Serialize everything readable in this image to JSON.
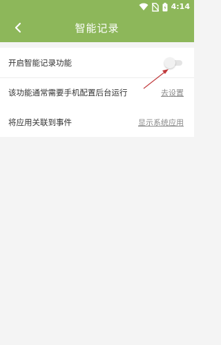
{
  "status_bar": {
    "time": "4:14",
    "icons": [
      "wifi-icon",
      "no-sim-icon",
      "battery-icon"
    ]
  },
  "app_bar": {
    "title": "智能记录",
    "back_icon": "chevron-left-icon"
  },
  "settings": {
    "smart_record": {
      "label": "开启智能记录功能",
      "enabled": false
    },
    "background_run": {
      "label": "该功能通常需要手机配置后台运行",
      "link": "去设置"
    },
    "link_app": {
      "label": "将应用关联到事件",
      "link": "显示系统应用"
    }
  },
  "colors": {
    "accent": "#8db75a",
    "annotation_arrow": "#c0393b"
  }
}
